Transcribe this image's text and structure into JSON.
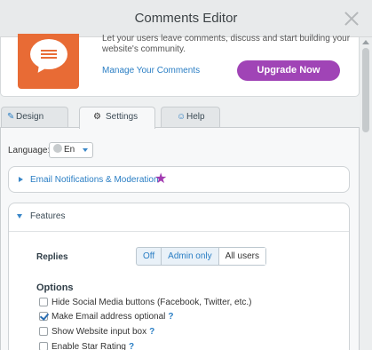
{
  "window": {
    "title": "Comments Editor"
  },
  "header": {
    "description": "Let your users leave comments, discuss and start building your website's community.",
    "manage_link": "Manage Your Comments",
    "upgrade_button": "Upgrade Now",
    "accent_color": "#a044b6",
    "icon_color": "#e86b35"
  },
  "tabs": [
    {
      "label": "Design",
      "icon": "brush-icon"
    },
    {
      "label": "Settings",
      "icon": "gear-icon"
    },
    {
      "label": "Help",
      "icon": "user-icon"
    }
  ],
  "settings": {
    "language_label": "Language:",
    "language_value": "En",
    "email_section": "Email Notifications & Moderation",
    "features_section": "Features",
    "replies_label": "Replies",
    "replies_options": [
      "Off",
      "Admin only",
      "All users"
    ],
    "replies_selected": "All users",
    "options_title": "Options",
    "options": [
      {
        "label": "Hide Social Media buttons (Facebook, Twitter, etc.)",
        "checked": false,
        "help": ""
      },
      {
        "label": "Make Email address optional",
        "checked": true,
        "help": "?"
      },
      {
        "label": "Show Website input box",
        "checked": false,
        "help": "?"
      },
      {
        "label": "Enable Star Rating",
        "checked": false,
        "help": "?"
      }
    ]
  }
}
